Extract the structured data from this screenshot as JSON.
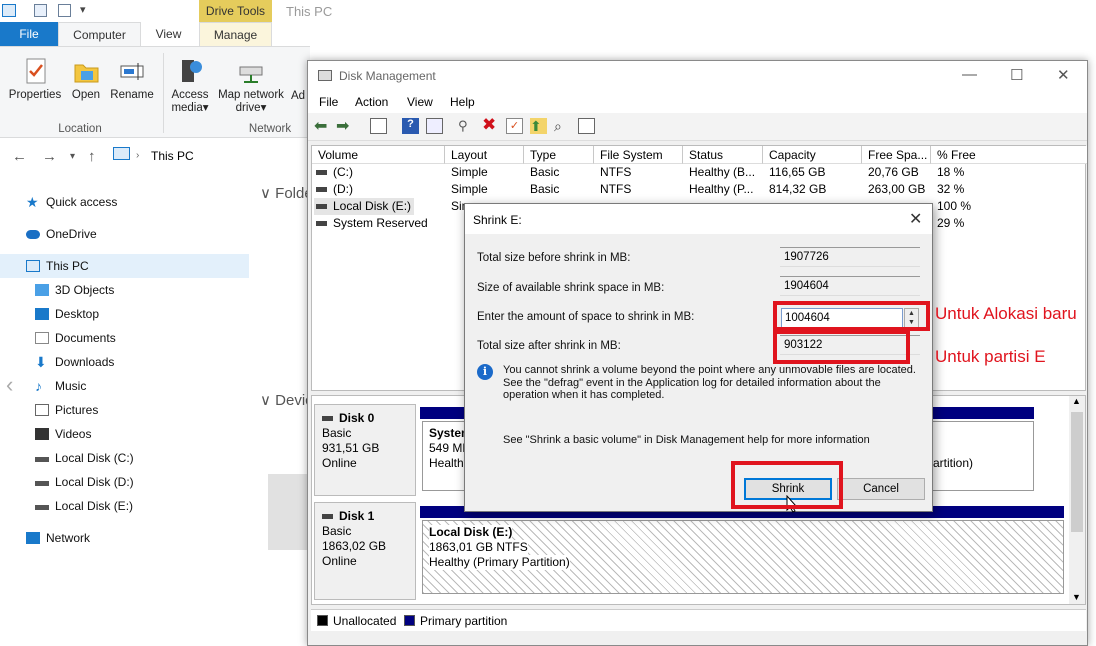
{
  "explorer": {
    "context_tab": "Drive Tools",
    "title": "This PC",
    "tabs": [
      "File",
      "Computer",
      "View",
      "Manage"
    ],
    "ribbon": {
      "location_buttons": [
        "Properties",
        "Open",
        "Rename"
      ],
      "location_group": "Location",
      "network_buttons": [
        "Access media",
        "Map network drive"
      ],
      "network_partial": "Ad",
      "network_group": "Network",
      "dropdown_arrow": "▾"
    },
    "address": {
      "path": "This PC"
    },
    "nav": {
      "quick_access": "Quick access",
      "onedrive": "OneDrive",
      "this_pc": "This PC",
      "items": [
        "3D Objects",
        "Desktop",
        "Documents",
        "Downloads",
        "Music",
        "Pictures",
        "Videos",
        "Local Disk (C:)",
        "Local Disk (D:)",
        "Local Disk (E:)"
      ],
      "network": "Network"
    },
    "folder_headers": [
      "Folde",
      "Devic"
    ]
  },
  "disk_mgmt": {
    "title": "Disk Management",
    "menu": [
      "File",
      "Action",
      "View",
      "Help"
    ],
    "columns": [
      "Volume",
      "Layout",
      "Type",
      "File System",
      "Status",
      "Capacity",
      "Free Spa...",
      "% Free"
    ],
    "rows": [
      [
        "(C:)",
        "Simple",
        "Basic",
        "NTFS",
        "Healthy (B...",
        "116,65 GB",
        "20,76 GB",
        "18 %"
      ],
      [
        "(D:)",
        "Simple",
        "Basic",
        "NTFS",
        "Healthy (P...",
        "814,32 GB",
        "263,00 GB",
        "32 %"
      ],
      [
        "Local Disk (E:)",
        "Sim",
        "",
        "",
        "",
        "",
        "",
        "100 %"
      ],
      [
        "System Reserved",
        "",
        "",
        "",
        "",
        "",
        "",
        "29 %"
      ]
    ],
    "disks": [
      {
        "name": "Disk 0",
        "type": "Basic",
        "size": "931,51 GB",
        "state": "Online",
        "part_title": "System",
        "part_size": "549 ME",
        "part_status": "Healthy",
        "part_tail": "artition)"
      },
      {
        "name": "Disk 1",
        "type": "Basic",
        "size": "1863,02 GB",
        "state": "Online",
        "part_title": "Local Disk  (E:)",
        "part_size": "1863,01 GB NTFS",
        "part_status": "Healthy (Primary Partition)"
      }
    ],
    "legend": [
      "Unallocated",
      "Primary partition"
    ],
    "colors": {
      "unallocated": "#000000",
      "primary": "#00007f"
    }
  },
  "dialog": {
    "title": "Shrink E:",
    "total_before_label": "Total size before shrink in MB:",
    "total_before_value": "1907726",
    "available_label": "Size of available shrink space in MB:",
    "available_value": "1904604",
    "amount_label": "Enter the amount of space to shrink in MB:",
    "amount_value": "1004604",
    "after_label": "Total size after shrink in MB:",
    "after_value": "903122",
    "info_text": "You cannot shrink a volume beyond the point where any unmovable files are located. See the \"defrag\" event in the Application log for detailed information about the operation when it has completed.",
    "help_text": "See \"Shrink a basic volume\" in Disk Management help for more information",
    "shrink_button": "Shrink",
    "cancel_button": "Cancel"
  },
  "annotations": {
    "new_allocation": "Untuk Alokasi baru",
    "partition_e": "Untuk partisi E",
    "color": "#e0141e"
  }
}
